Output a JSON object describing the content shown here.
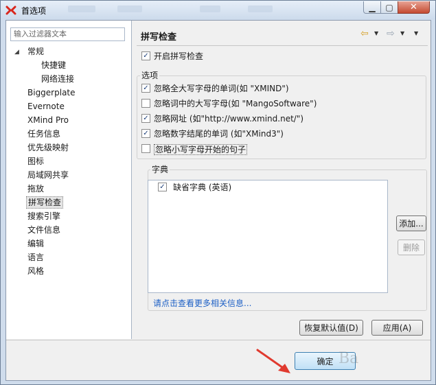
{
  "window": {
    "title": "首选项"
  },
  "left": {
    "filter_placeholder": "输入过滤器文本",
    "tree": [
      {
        "label": "常规",
        "level": 0,
        "expanded": true
      },
      {
        "label": "快捷键",
        "level": 1
      },
      {
        "label": "网络连接",
        "level": 1
      },
      {
        "label": "Biggerplate",
        "level": 0
      },
      {
        "label": "Evernote",
        "level": 0
      },
      {
        "label": "XMind Pro",
        "level": 0
      },
      {
        "label": "任务信息",
        "level": 0
      },
      {
        "label": "优先级映射",
        "level": 0
      },
      {
        "label": "图标",
        "level": 0
      },
      {
        "label": "局域网共享",
        "level": 0
      },
      {
        "label": "拖放",
        "level": 0
      },
      {
        "label": "拼写检查",
        "level": 0,
        "selected": true
      },
      {
        "label": "搜索引擎",
        "level": 0
      },
      {
        "label": "文件信息",
        "level": 0
      },
      {
        "label": "编辑",
        "level": 0
      },
      {
        "label": "语言",
        "level": 0
      },
      {
        "label": "风格",
        "level": 0
      }
    ]
  },
  "page": {
    "title": "拼写检查",
    "enable_spell_check": {
      "label": "开启拼写检查",
      "checked": true
    },
    "options_group_title": "选项",
    "options": [
      {
        "label": "忽略全大写字母的单词(如 \"XMIND\")",
        "checked": true
      },
      {
        "label": "忽略词中的大写字母(如 \"MangoSoftware\")",
        "checked": false
      },
      {
        "label": "忽略网址 (如\"http://www.xmind.net/\")",
        "checked": true
      },
      {
        "label": "忽略数字结尾的单词 (如\"XMind3\")",
        "checked": true
      },
      {
        "label": "忽略小写字母开始的句子",
        "checked": false
      }
    ],
    "dictionary_group_title": "字典",
    "dictionaries": [
      {
        "label": "缺省字典 (英语)",
        "checked": true
      }
    ],
    "add_button": "添加...",
    "delete_button": "删除",
    "more_info_link": "请点击查看更多相关信息...",
    "restore_defaults_button": "恢复默认值(D)",
    "apply_button": "应用(A)"
  },
  "footer": {
    "ok_button": "确定",
    "watermark": "Ba"
  },
  "colors": {
    "link": "#1c5fc5",
    "annotation_arrow": "#e03a2f",
    "ok_button_border": "#3c7fb1"
  }
}
